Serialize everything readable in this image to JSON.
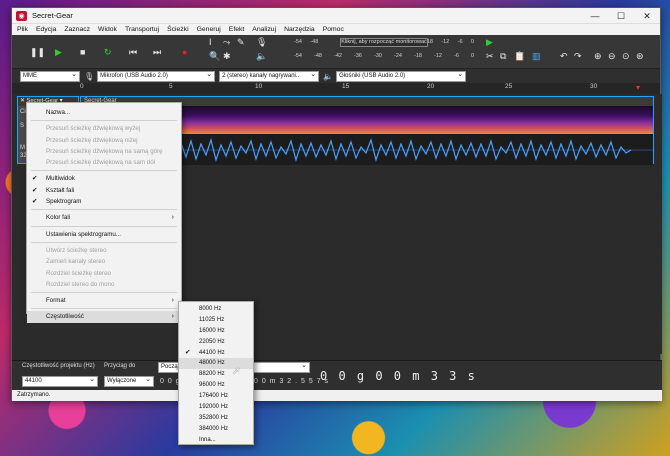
{
  "window": {
    "title": "Secret-Gear",
    "controls": [
      "—",
      "☐",
      "✕"
    ]
  },
  "menubar": [
    "Plik",
    "Edycja",
    "Zaznacz",
    "Widok",
    "Transportuj",
    "Ścieżki",
    "Generuj",
    "Efekt",
    "Analizuj",
    "Narzędzia",
    "Pomoc"
  ],
  "toolbar": {
    "meter_hint": "Kliknij, aby rozpocząć monitorować",
    "meter_scale": [
      "-54",
      "-48",
      "-42",
      "-36",
      "-30",
      "-24",
      "-18",
      "-12",
      "-6",
      "0"
    ],
    "meter_labels": [
      "L",
      "R"
    ]
  },
  "devices": {
    "host": "MME",
    "input": "Mikrofon (USB Audio 2.0)",
    "channels": "2 (stereo) kanały nagrywani..",
    "output": "Głośniki (USB Audio 2.0)"
  },
  "ruler": {
    "ticks": [
      "0",
      "5",
      "10",
      "15",
      "20",
      "25",
      "30"
    ]
  },
  "track": {
    "name": "Secret-Gear",
    "clip_title": "Secret-Gear",
    "side_labels": [
      "Ci",
      "S",
      "M",
      "32"
    ]
  },
  "context_menu": {
    "items": [
      {
        "label": "Nazwa...",
        "disabled": false
      },
      {
        "sep": true
      },
      {
        "label": "Przesuń ścieżkę dźwiękową wyżej",
        "disabled": true
      },
      {
        "label": "Przesuń ścieżkę dźwiękową niżej",
        "disabled": true
      },
      {
        "label": "Przesuń ścieżkę dźwiękową na samą górę",
        "disabled": true
      },
      {
        "label": "Przesuń ścieżkę dźwiękową na sam dół",
        "disabled": true
      },
      {
        "sep": true
      },
      {
        "label": "Multiwidok",
        "checked": true
      },
      {
        "label": "Kształt fali",
        "checked": true
      },
      {
        "label": "Spektrogram",
        "checked": true
      },
      {
        "sep": true
      },
      {
        "label": "Kolor fali",
        "submenu": true
      },
      {
        "sep": true
      },
      {
        "label": "Ustawienia spektrogramu..."
      },
      {
        "sep": true
      },
      {
        "label": "Utwórz ścieżkę stereo",
        "disabled": true
      },
      {
        "label": "Zamień kanały stereo",
        "disabled": true
      },
      {
        "label": "Rozdziel ścieżkę stereo",
        "disabled": true
      },
      {
        "label": "Rozdziel stereo do mono",
        "disabled": true
      },
      {
        "sep": true
      },
      {
        "label": "Format",
        "submenu": true
      },
      {
        "sep": true
      },
      {
        "label": "Częstotliwość",
        "submenu": true,
        "highlight": true
      }
    ]
  },
  "rate_submenu": {
    "items": [
      {
        "label": "8000 Hz"
      },
      {
        "label": "11025 Hz"
      },
      {
        "label": "16000 Hz"
      },
      {
        "label": "22050 Hz"
      },
      {
        "label": "44100 Hz",
        "checked": true
      },
      {
        "label": "48000 Hz",
        "highlight": true
      },
      {
        "label": "88200 Hz"
      },
      {
        "label": "96000 Hz"
      },
      {
        "label": "176400 Hz"
      },
      {
        "label": "192000 Hz"
      },
      {
        "label": "352800 Hz"
      },
      {
        "label": "384000 Hz"
      },
      {
        "label": "Inna..."
      }
    ]
  },
  "bottom": {
    "rate_label": "Częstotliwość projektu (Hz)",
    "rate_value": "44100",
    "snap_label": "Przyciąg do",
    "snap_value": "Wyłączone",
    "start_label": "Począt",
    "pos_small_left": "0 0 g",
    "pos_small": "0 0 m 3 2 . 5 5 7 s",
    "time_big": "0 0 g 0 0 m 3 3 s"
  },
  "status": "Zatrzymano."
}
